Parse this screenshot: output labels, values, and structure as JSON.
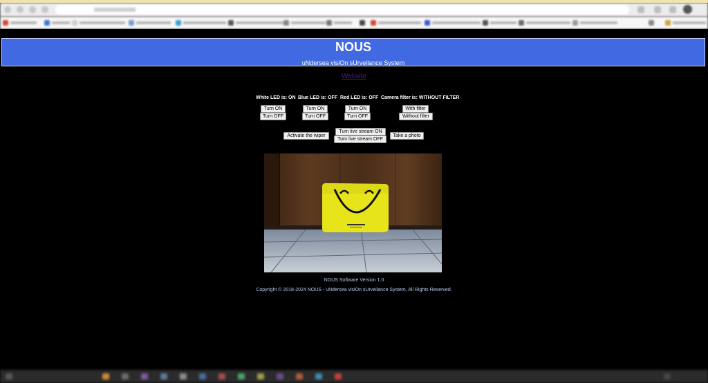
{
  "app": {
    "title": "NOUS",
    "subtitle": "uNdersea visiOn sUrveilance System",
    "website_link": "Website"
  },
  "status": {
    "white_led": "White LED is: ON",
    "blue_led": "Blue LED is: OFF",
    "red_led": "Red LED is: OFF",
    "camera_filter": "Camera filter is: WITHOUT FILTER"
  },
  "controls": {
    "white_on": "Turn ON",
    "white_off": "Turn OFF",
    "blue_on": "Turn ON",
    "blue_off": "Turn OFF",
    "red_on": "Turn ON",
    "red_off": "Turn OFF",
    "filter_on": "With filter",
    "filter_off": "Without filter",
    "wiper": "Activate the wiper",
    "stream_on": "Turn live stream ON",
    "stream_off": "Turn live stream OFF",
    "photo": "Take a photo"
  },
  "footer": {
    "version": "NOUS Software Version 1.0",
    "copyright": "Copyright © 2018-2024 NOUS - uNdersea visiOn sUrveilance System, All Rights Reserved."
  },
  "colors": {
    "header_bg": "#4169e1",
    "page_bg": "#000000",
    "link": "#551a8b",
    "footer_text": "#b8c8f0"
  }
}
